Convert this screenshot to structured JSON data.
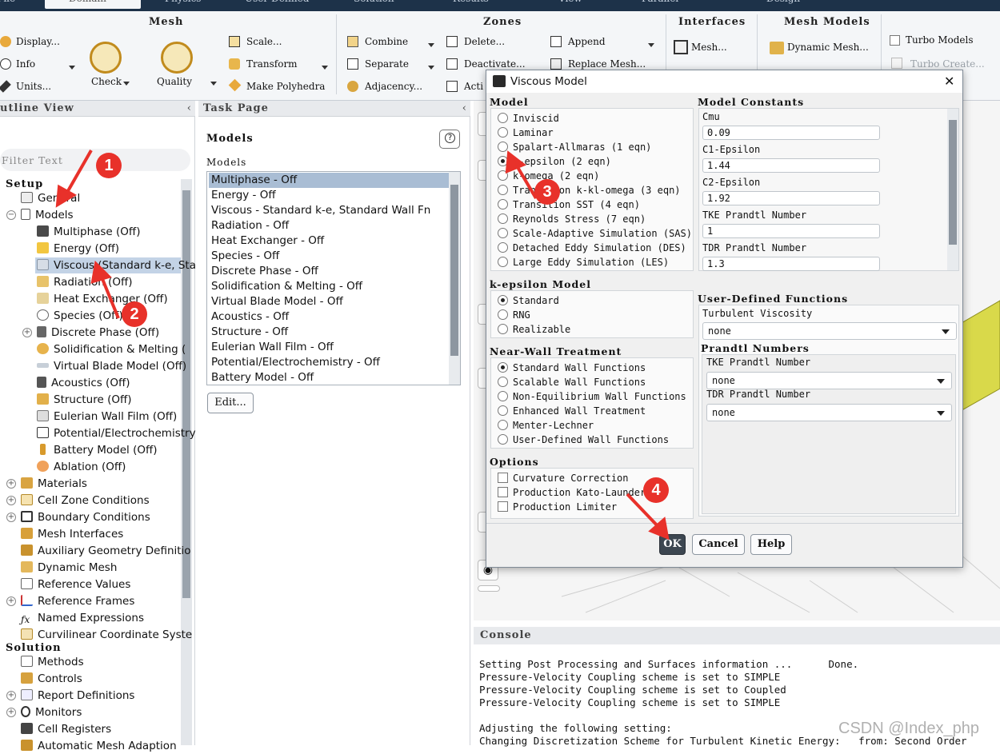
{
  "tabs": [
    "File",
    "Domain",
    "Physics",
    "User-Defined",
    "Solution",
    "Results",
    "View",
    "Parallel",
    "Design"
  ],
  "ribbon": {
    "mesh_group": "Mesh",
    "display": "Display...",
    "info": "Info",
    "units": "Units...",
    "check": "Check",
    "quality": "Quality",
    "scale": "Scale...",
    "transform": "Transform",
    "make_polyhedra": "Make Polyhedra",
    "zones_group": "Zones",
    "combine": "Combine",
    "separate": "Separate",
    "adjacency": "Adjacency...",
    "delete": "Delete...",
    "deactivate": "Deactivate...",
    "activate": "Acti",
    "append": "Append",
    "replace_mesh": "Replace Mesh...",
    "interfaces_group": "Interfaces",
    "mesh_interfaces": "Mesh...",
    "mesh_models_group": "Mesh Models",
    "dynamic_mesh": "Dynamic Mesh...",
    "turbo_models": "Turbo Models",
    "turbo_create": "Turbo Create..."
  },
  "outline": {
    "title": "utline View",
    "filter_placeholder": "Filter Text",
    "setup_label": "Setup",
    "solution_label": "Solution",
    "items": [
      "General",
      "Models",
      "Multiphase (Off)",
      "Energy (Off)",
      "Viscous (Standard k-e, Sta",
      "Radiation (Off)",
      "Heat Exchanger (Off)",
      "Species (Off)",
      "Discrete Phase (Off)",
      "Solidification & Melting (",
      "Virtual Blade Model (Off)",
      "Acoustics (Off)",
      "Structure (Off)",
      "Eulerian Wall Film (Off)",
      "Potential/Electrochemistry",
      "Battery Model (Off)",
      "Ablation (Off)",
      "Materials",
      "Cell Zone Conditions",
      "Boundary Conditions",
      "Mesh Interfaces",
      "Auxiliary Geometry Definitio",
      "Dynamic Mesh",
      "Reference Values",
      "Reference Frames",
      "Named Expressions",
      "Curvilinear Coordinate Syste"
    ],
    "solution_items": [
      "Methods",
      "Controls",
      "Report Definitions",
      "Monitors",
      "Cell Registers",
      "Automatic Mesh Adaption"
    ]
  },
  "task": {
    "title": "Task Page",
    "heading": "Models",
    "list_label": "Models",
    "help": "?",
    "models": [
      "Multiphase - Off",
      "Energy - Off",
      "Viscous - Standard k-e, Standard Wall Fn",
      "Radiation - Off",
      "Heat Exchanger - Off",
      "Species - Off",
      "Discrete Phase - Off",
      "Solidification & Melting - Off",
      "Virtual Blade Model - Off",
      "Acoustics - Off",
      "Structure - Off",
      "Eulerian Wall Film - Off",
      "Potential/Electrochemistry - Off",
      "Battery Model - Off"
    ],
    "edit": "Edit..."
  },
  "dialog": {
    "title": "Viscous Model",
    "model_group": "Model",
    "models": [
      "Inviscid",
      "Laminar",
      "Spalart-Allmaras (1 eqn)",
      "k-epsilon (2 eqn)",
      "k-omega (2 eqn)",
      "Transition k-kl-omega (3 eqn)",
      "Transition SST (4 eqn)",
      "Reynolds Stress (7 eqn)",
      "Scale-Adaptive Simulation (SAS)",
      "Detached Eddy Simulation (DES)",
      "Large Eddy Simulation (LES)"
    ],
    "selected_model": "k-epsilon (2 eqn)",
    "kepsilon_group": "k-epsilon Model",
    "kepsilon_options": [
      "Standard",
      "RNG",
      "Realizable"
    ],
    "selected_kepsilon": "Standard",
    "nearwall_group": "Near-Wall Treatment",
    "nearwall_options": [
      "Standard Wall Functions",
      "Scalable Wall Functions",
      "Non-Equilibrium Wall Functions",
      "Enhanced Wall Treatment",
      "Menter-Lechner",
      "User-Defined Wall Functions"
    ],
    "selected_nearwall": "Standard Wall Functions",
    "options_group": "Options",
    "options": [
      "Curvature Correction",
      "Production Kato-Launder",
      "Production Limiter"
    ],
    "constants_group": "Model Constants",
    "constants": [
      {
        "label": "Cmu",
        "value": "0.09"
      },
      {
        "label": "C1-Epsilon",
        "value": "1.44"
      },
      {
        "label": "C2-Epsilon",
        "value": "1.92"
      },
      {
        "label": "TKE Prandtl Number",
        "value": "1"
      },
      {
        "label": "TDR Prandtl Number",
        "value": "1.3"
      }
    ],
    "udf_group": "User-Defined Functions",
    "turbulent_viscosity_label": "Turbulent Viscosity",
    "turbulent_viscosity_value": "none",
    "prandtl_group": "Prandtl Numbers",
    "tke_label": "TKE Prandtl Number",
    "tke_value": "none",
    "tdr_label": "TDR Prandtl Number",
    "tdr_value": "none",
    "ok": "OK",
    "cancel": "Cancel",
    "help": "Help",
    "close": "✕"
  },
  "console": {
    "title": "Console",
    "lines": [
      "Setting Post Processing and Surfaces information ...      Done.",
      "Pressure-Velocity Coupling scheme is set to SIMPLE",
      "Pressure-Velocity Coupling scheme is set to Coupled",
      "Pressure-Velocity Coupling scheme is set to SIMPLE",
      "",
      "Adjusting the following setting:",
      "Changing Discretization Scheme for Turbulent Kinetic Energy:   from: Second Order"
    ]
  },
  "annotations": [
    "1",
    "2",
    "3",
    "4"
  ],
  "watermark": "CSDN @Index_php",
  "colors": {
    "accent_red": "#e8312a",
    "tab_bar": "#1d3249",
    "selection": "#a9bdd4",
    "ok_button": "#3c4650",
    "geometry_yellow": "#d9d94a"
  }
}
